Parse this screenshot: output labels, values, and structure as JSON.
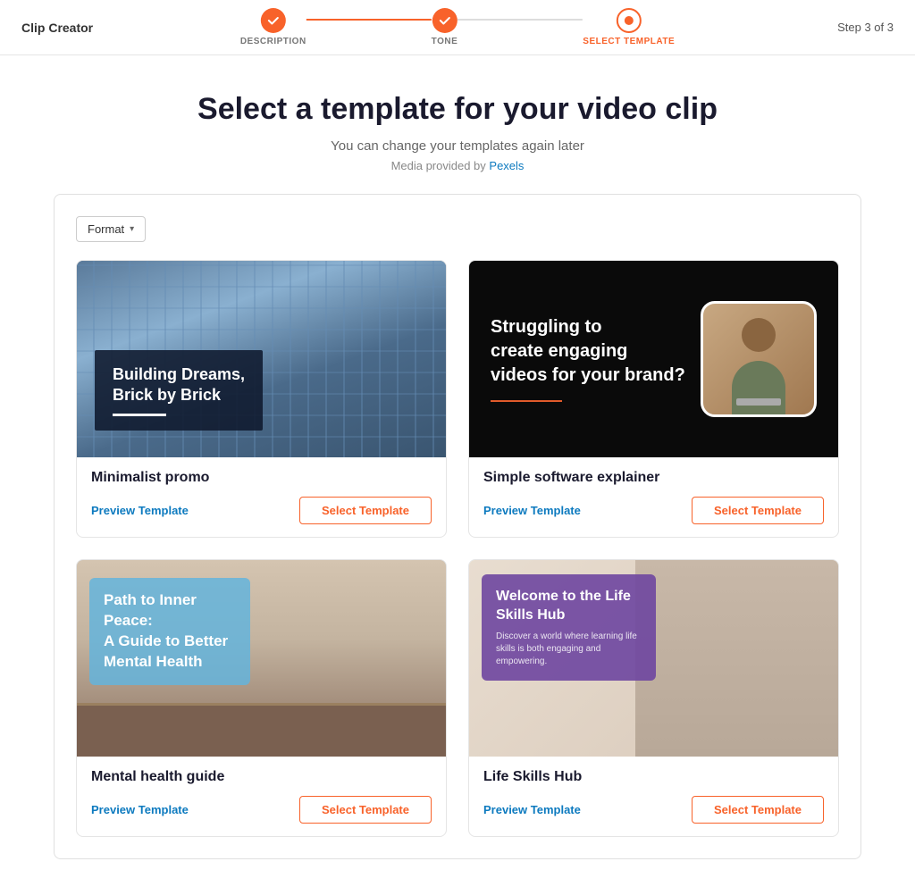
{
  "app": {
    "title": "Clip Creator",
    "step_indicator": "Step 3 of 3"
  },
  "progress": {
    "steps": [
      {
        "id": "description",
        "label": "DESCRIPTION",
        "state": "done"
      },
      {
        "id": "tone",
        "label": "TONE",
        "state": "done"
      },
      {
        "id": "select-template",
        "label": "SELECT TEMPLATE",
        "state": "active"
      }
    ]
  },
  "page": {
    "heading": "Select a template for your video clip",
    "subheading": "You can change your templates again later",
    "media_credit_prefix": "Media provided by ",
    "media_credit_link": "Pexels"
  },
  "filter": {
    "label": "Format",
    "chevron": "▾"
  },
  "templates": [
    {
      "id": "minimalist-promo",
      "name": "Minimalist promo",
      "preview_label": "Preview Template",
      "select_label": "Select Template",
      "preview_text": "Building Dreams,\nBrick by Brick"
    },
    {
      "id": "software-explainer",
      "name": "Simple software explainer",
      "preview_label": "Preview Template",
      "select_label": "Select Template",
      "preview_text": "Struggling to create engaging videos for your brand?"
    },
    {
      "id": "mental-health",
      "name": "Mental health guide",
      "preview_label": "Preview Template",
      "select_label": "Select Template",
      "preview_text": "Path to Inner Peace: A Guide to Better Mental Health"
    },
    {
      "id": "life-skills",
      "name": "Life Skills Hub",
      "preview_label": "Preview Template",
      "select_label": "Select Template",
      "preview_title": "Welcome to the Life Skills Hub",
      "preview_sub": "Discover a world where learning life skills is both engaging and empowering."
    }
  ]
}
